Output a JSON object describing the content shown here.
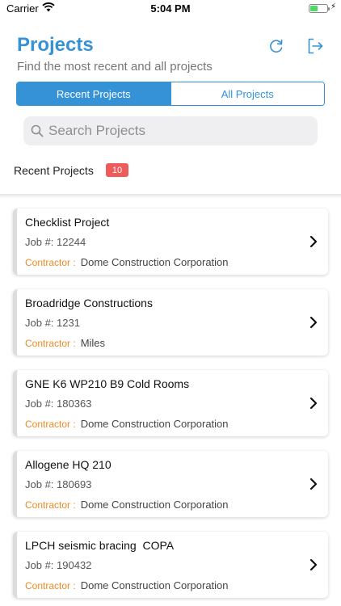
{
  "status_bar": {
    "carrier": "Carrier",
    "time": "5:04 PM",
    "battery_level": 0.42
  },
  "header": {
    "title": "Projects",
    "subtitle": "Find the most recent and all projects",
    "refresh_icon": "refresh-icon",
    "logout_icon": "logout-icon"
  },
  "tabs": [
    {
      "label": "Recent Projects",
      "active": true
    },
    {
      "label": "All Projects",
      "active": false
    }
  ],
  "search": {
    "placeholder": "Search Projects",
    "value": ""
  },
  "section": {
    "label": "Recent Projects",
    "count": "10"
  },
  "colors": {
    "accent": "#3592d6",
    "badge": "#ee5b5b",
    "contractor_label": "#ef8a1f"
  },
  "projects": [
    {
      "title": "Checklist Project",
      "job": "Job #: 12244",
      "contractor_label": "Contractor :",
      "contractor": "Dome Construction Corporation"
    },
    {
      "title": "Broadridge Constructions",
      "job": "Job #: 1231",
      "contractor_label": "Contractor :",
      "contractor": "Miles"
    },
    {
      "title": "GNE K6 WP210 B9 Cold Rooms",
      "job": "Job #: 180363",
      "contractor_label": "Contractor :",
      "contractor": "Dome Construction Corporation"
    },
    {
      "title": "Allogene HQ 210",
      "job": "Job #: 180693",
      "contractor_label": "Contractor :",
      "contractor": "Dome Construction Corporation"
    },
    {
      "title": "LPCH seismic bracing  COPA",
      "job": "Job #: 190432",
      "contractor_label": "Contractor :",
      "contractor": "Dome Construction Corporation"
    }
  ]
}
